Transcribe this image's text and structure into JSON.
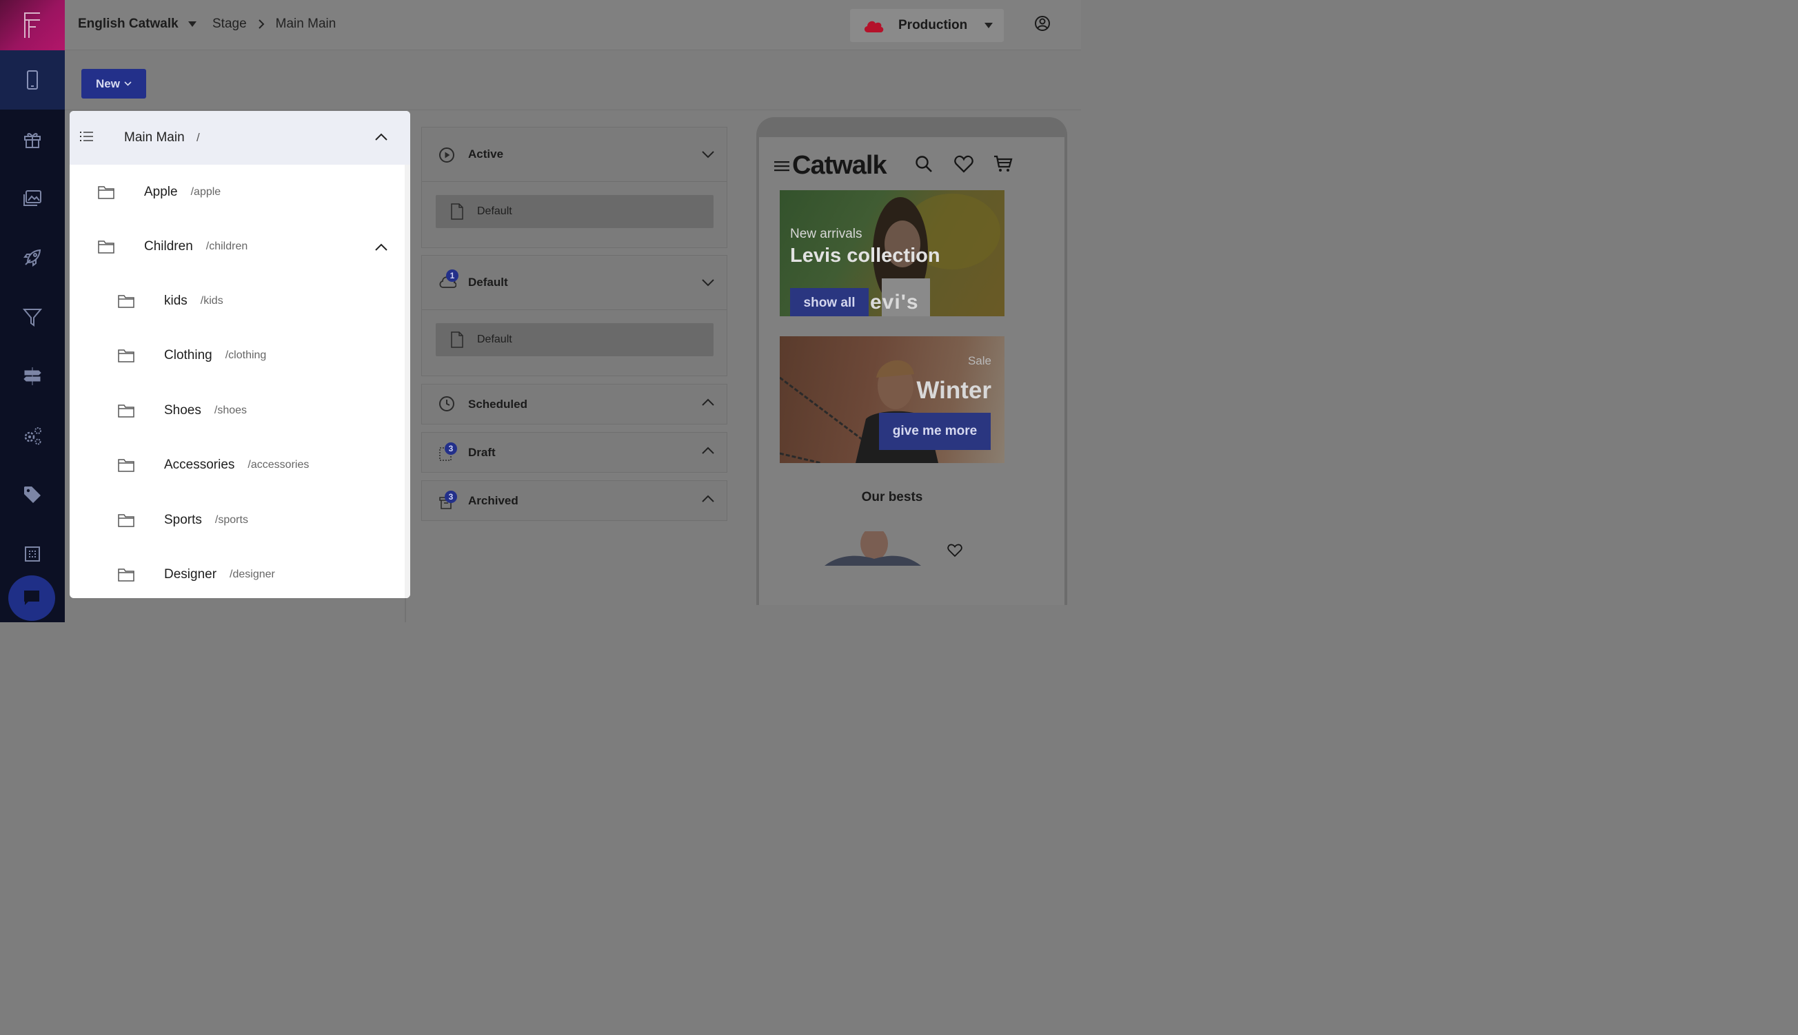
{
  "app": {
    "logo_letter": "F"
  },
  "topbar": {
    "project": "English Catwalk",
    "breadcrumb": [
      "Stage",
      "Main Main"
    ],
    "environment": "Production"
  },
  "toolbar": {
    "new_label": "New"
  },
  "tree": {
    "root": {
      "name": "Main Main",
      "path": "/"
    },
    "items": [
      {
        "name": "Apple",
        "path": "/apple",
        "level": 1
      },
      {
        "name": "Children",
        "path": "/children",
        "level": 1,
        "expanded": true
      },
      {
        "name": "kids",
        "path": "/kids",
        "level": 2
      },
      {
        "name": "Clothing",
        "path": "/clothing",
        "level": 2
      },
      {
        "name": "Shoes",
        "path": "/shoes",
        "level": 2
      },
      {
        "name": "Accessories",
        "path": "/accessories",
        "level": 2
      },
      {
        "name": "Sports",
        "path": "/sports",
        "level": 2
      },
      {
        "name": "Designer",
        "path": "/designer",
        "level": 2
      }
    ]
  },
  "variants": {
    "active": {
      "label": "Active",
      "item": "Default"
    },
    "default": {
      "label": "Default",
      "badge": "1",
      "item": "Default"
    },
    "scheduled": {
      "label": "Scheduled"
    },
    "draft": {
      "label": "Draft",
      "badge": "3"
    },
    "archived": {
      "label": "Archived",
      "badge": "3"
    }
  },
  "preview": {
    "brand": "Catwalk",
    "banner1": {
      "kicker": "New arrivals",
      "title": "Levis collection",
      "button": "show all",
      "watermark": "evi's"
    },
    "banner2": {
      "kicker": "Sale",
      "title": "Winter",
      "button": "give me more"
    },
    "section_title": "Our bests"
  },
  "colors": {
    "accent": "#23308a",
    "sidebar": "#0c1024",
    "cloud": "#b4122a"
  }
}
